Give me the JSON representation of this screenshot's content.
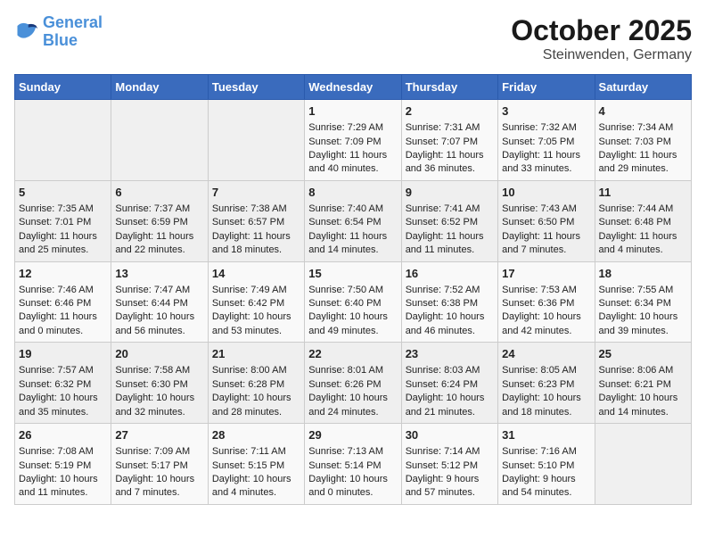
{
  "header": {
    "logo_line1": "General",
    "logo_line2": "Blue",
    "month": "October 2025",
    "location": "Steinwenden, Germany"
  },
  "days_of_week": [
    "Sunday",
    "Monday",
    "Tuesday",
    "Wednesday",
    "Thursday",
    "Friday",
    "Saturday"
  ],
  "weeks": [
    [
      {
        "day": "",
        "info": ""
      },
      {
        "day": "",
        "info": ""
      },
      {
        "day": "",
        "info": ""
      },
      {
        "day": "1",
        "info": "Sunrise: 7:29 AM\nSunset: 7:09 PM\nDaylight: 11 hours and 40 minutes."
      },
      {
        "day": "2",
        "info": "Sunrise: 7:31 AM\nSunset: 7:07 PM\nDaylight: 11 hours and 36 minutes."
      },
      {
        "day": "3",
        "info": "Sunrise: 7:32 AM\nSunset: 7:05 PM\nDaylight: 11 hours and 33 minutes."
      },
      {
        "day": "4",
        "info": "Sunrise: 7:34 AM\nSunset: 7:03 PM\nDaylight: 11 hours and 29 minutes."
      }
    ],
    [
      {
        "day": "5",
        "info": "Sunrise: 7:35 AM\nSunset: 7:01 PM\nDaylight: 11 hours and 25 minutes."
      },
      {
        "day": "6",
        "info": "Sunrise: 7:37 AM\nSunset: 6:59 PM\nDaylight: 11 hours and 22 minutes."
      },
      {
        "day": "7",
        "info": "Sunrise: 7:38 AM\nSunset: 6:57 PM\nDaylight: 11 hours and 18 minutes."
      },
      {
        "day": "8",
        "info": "Sunrise: 7:40 AM\nSunset: 6:54 PM\nDaylight: 11 hours and 14 minutes."
      },
      {
        "day": "9",
        "info": "Sunrise: 7:41 AM\nSunset: 6:52 PM\nDaylight: 11 hours and 11 minutes."
      },
      {
        "day": "10",
        "info": "Sunrise: 7:43 AM\nSunset: 6:50 PM\nDaylight: 11 hours and 7 minutes."
      },
      {
        "day": "11",
        "info": "Sunrise: 7:44 AM\nSunset: 6:48 PM\nDaylight: 11 hours and 4 minutes."
      }
    ],
    [
      {
        "day": "12",
        "info": "Sunrise: 7:46 AM\nSunset: 6:46 PM\nDaylight: 11 hours and 0 minutes."
      },
      {
        "day": "13",
        "info": "Sunrise: 7:47 AM\nSunset: 6:44 PM\nDaylight: 10 hours and 56 minutes."
      },
      {
        "day": "14",
        "info": "Sunrise: 7:49 AM\nSunset: 6:42 PM\nDaylight: 10 hours and 53 minutes."
      },
      {
        "day": "15",
        "info": "Sunrise: 7:50 AM\nSunset: 6:40 PM\nDaylight: 10 hours and 49 minutes."
      },
      {
        "day": "16",
        "info": "Sunrise: 7:52 AM\nSunset: 6:38 PM\nDaylight: 10 hours and 46 minutes."
      },
      {
        "day": "17",
        "info": "Sunrise: 7:53 AM\nSunset: 6:36 PM\nDaylight: 10 hours and 42 minutes."
      },
      {
        "day": "18",
        "info": "Sunrise: 7:55 AM\nSunset: 6:34 PM\nDaylight: 10 hours and 39 minutes."
      }
    ],
    [
      {
        "day": "19",
        "info": "Sunrise: 7:57 AM\nSunset: 6:32 PM\nDaylight: 10 hours and 35 minutes."
      },
      {
        "day": "20",
        "info": "Sunrise: 7:58 AM\nSunset: 6:30 PM\nDaylight: 10 hours and 32 minutes."
      },
      {
        "day": "21",
        "info": "Sunrise: 8:00 AM\nSunset: 6:28 PM\nDaylight: 10 hours and 28 minutes."
      },
      {
        "day": "22",
        "info": "Sunrise: 8:01 AM\nSunset: 6:26 PM\nDaylight: 10 hours and 24 minutes."
      },
      {
        "day": "23",
        "info": "Sunrise: 8:03 AM\nSunset: 6:24 PM\nDaylight: 10 hours and 21 minutes."
      },
      {
        "day": "24",
        "info": "Sunrise: 8:05 AM\nSunset: 6:23 PM\nDaylight: 10 hours and 18 minutes."
      },
      {
        "day": "25",
        "info": "Sunrise: 8:06 AM\nSunset: 6:21 PM\nDaylight: 10 hours and 14 minutes."
      }
    ],
    [
      {
        "day": "26",
        "info": "Sunrise: 7:08 AM\nSunset: 5:19 PM\nDaylight: 10 hours and 11 minutes."
      },
      {
        "day": "27",
        "info": "Sunrise: 7:09 AM\nSunset: 5:17 PM\nDaylight: 10 hours and 7 minutes."
      },
      {
        "day": "28",
        "info": "Sunrise: 7:11 AM\nSunset: 5:15 PM\nDaylight: 10 hours and 4 minutes."
      },
      {
        "day": "29",
        "info": "Sunrise: 7:13 AM\nSunset: 5:14 PM\nDaylight: 10 hours and 0 minutes."
      },
      {
        "day": "30",
        "info": "Sunrise: 7:14 AM\nSunset: 5:12 PM\nDaylight: 9 hours and 57 minutes."
      },
      {
        "day": "31",
        "info": "Sunrise: 7:16 AM\nSunset: 5:10 PM\nDaylight: 9 hours and 54 minutes."
      },
      {
        "day": "",
        "info": ""
      }
    ]
  ]
}
